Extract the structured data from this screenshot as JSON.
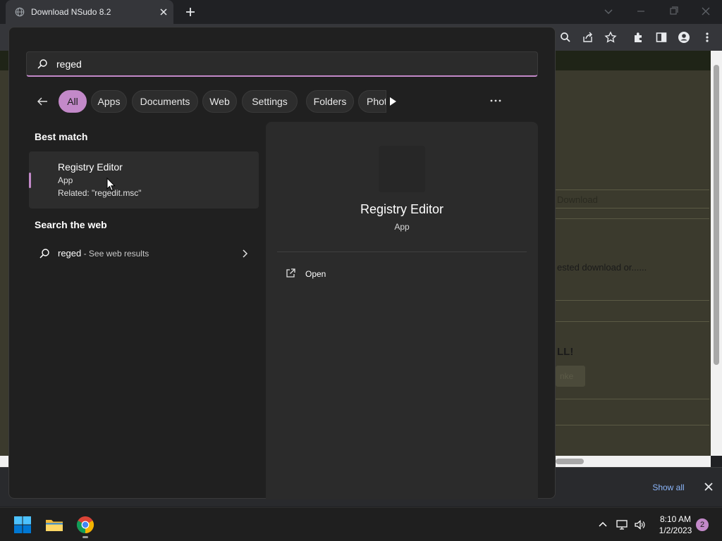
{
  "browser": {
    "tab_title": "Download NSudo 8.2",
    "favicon": "globe-icon",
    "page_texts": {
      "download_label": "Download",
      "requested_text": "ested download or......",
      "all_text": "LL!",
      "button_text": "nke"
    }
  },
  "download_bar": {
    "show_all_label": "Show all"
  },
  "search": {
    "query": "reged",
    "filters": [
      {
        "label": "All",
        "active": true
      },
      {
        "label": "Apps",
        "active": false
      },
      {
        "label": "Documents",
        "active": false
      },
      {
        "label": "Web",
        "active": false
      },
      {
        "label": "Settings",
        "active": false
      },
      {
        "label": "Folders",
        "active": false
      },
      {
        "label": "Photos",
        "active": false
      }
    ],
    "best_match": {
      "section_title": "Best match",
      "title": "Registry Editor",
      "type": "App",
      "related": "Related: \"regedit.msc\""
    },
    "web": {
      "section_title": "Search the web",
      "query": "reged",
      "suffix": " - See web results"
    },
    "detail": {
      "title": "Registry Editor",
      "type": "App",
      "actions": [
        {
          "label": "Open",
          "icon": "open-external-icon"
        }
      ]
    },
    "accent_color": "#c389c9"
  },
  "taskbar": {
    "apps": [
      "windows-start-icon",
      "file-explorer-icon",
      "chrome-icon"
    ],
    "time": "8:10 AM",
    "date": "1/2/2023",
    "notification_count": "2"
  }
}
